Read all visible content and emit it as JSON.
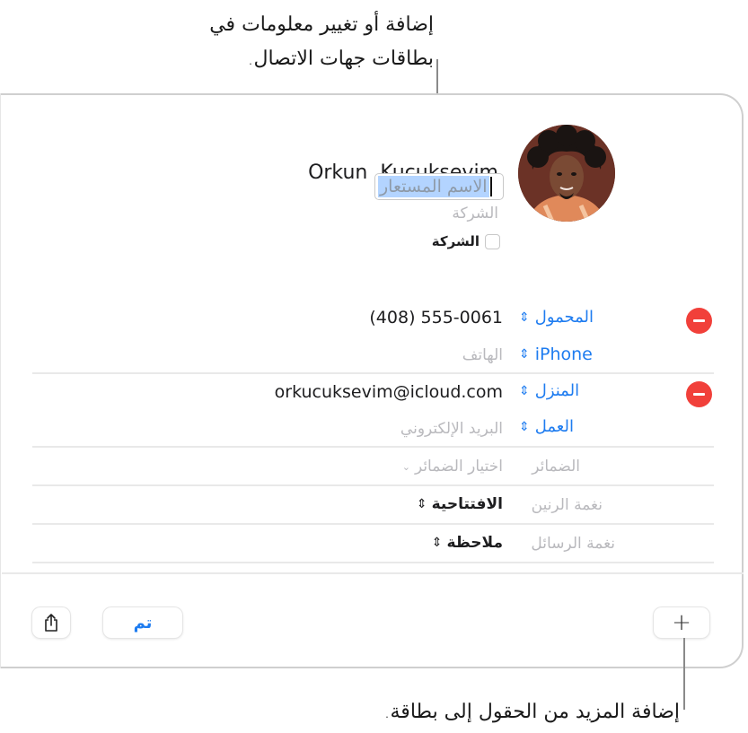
{
  "callouts": {
    "top": {
      "line1": "إضافة أو تغيير معلومات في",
      "line2": "بطاقات جهات الاتصال."
    },
    "bottom": {
      "text": "إضافة المزيد من الحقول إلى بطاقة."
    }
  },
  "contact": {
    "first_name": "Orkun",
    "last_name": "Kucuksevim",
    "nickname_placeholder": "الاسم المستعار",
    "company_placeholder": "الشركة",
    "company_checkbox_label": "الشركة",
    "company_checkbox_checked": false
  },
  "phone_section": {
    "rows": [
      {
        "label": "المحمول",
        "value": "(408) 555-0061",
        "removable": true
      },
      {
        "label": "iPhone",
        "value": "الهاتف",
        "value_is_placeholder": true,
        "removable": false
      }
    ]
  },
  "email_section": {
    "rows": [
      {
        "label": "المنزل",
        "value": "orkucuksevim@icloud.com",
        "removable": true
      },
      {
        "label": "العمل",
        "value": "البريد الإلكتروني",
        "value_is_placeholder": true,
        "removable": false
      }
    ]
  },
  "pronouns": {
    "label": "الضمائر",
    "value": "اختيار الضمائر"
  },
  "ringtone": {
    "label": "نغمة الرنين",
    "value": "الافتتاحية"
  },
  "text_tone": {
    "label": "نغمة الرسائل",
    "value": "ملاحظة"
  },
  "footer": {
    "add_field_label": "+",
    "done_label": "تم",
    "share_icon": "share-icon"
  },
  "colors": {
    "accent_blue": "#1e7cf0",
    "remove_red": "#f1403a",
    "selection": "#b3d4ff"
  }
}
